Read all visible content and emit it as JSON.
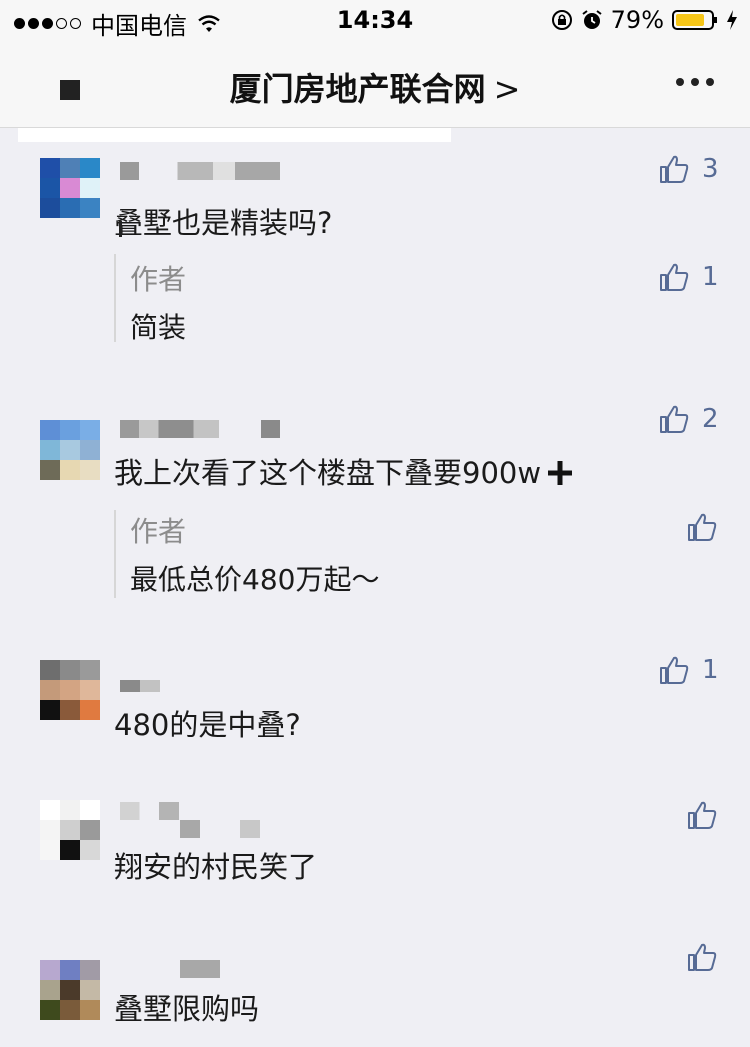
{
  "status_bar": {
    "carrier": "中国电信",
    "time": "14:34",
    "battery": "79%"
  },
  "nav": {
    "title": "厦门房地产联合网",
    "chevron": ">"
  },
  "comments": [
    {
      "text": "叠墅也是精装吗?",
      "likes": "3",
      "avatar_colors": [
        "#1f4fa8",
        "#4f80b6",
        "#2a88c8",
        "#1b55a6",
        "#d98ad4",
        "#dff2f8",
        "#1c4d9c",
        "#2a6db3",
        "#3b83c2"
      ],
      "reply": {
        "author": "作者",
        "text": "简装",
        "likes": "1"
      }
    },
    {
      "text": "我上次看了这个楼盘下叠要900w",
      "likes": "2",
      "avatar_colors": [
        "#5e8fd6",
        "#6aa0df",
        "#7aaee6",
        "#7fb7d8",
        "#a8c9e0",
        "#8fb1d4",
        "#6e6b58",
        "#e7d8b2",
        "#e8ddc2"
      ],
      "reply": {
        "author": "作者",
        "text": "最低总价480万起～",
        "likes": ""
      }
    },
    {
      "text": "480的是中叠?",
      "likes": "1",
      "avatar_colors": [
        "#6e6e6e",
        "#8a8a8a",
        "#9a9a9a",
        "#c49a7a",
        "#d3a483",
        "#dfb79a",
        "#111111",
        "#8a5a3a",
        "#e07a40"
      ],
      "avatar_row3b": "#221a16",
      "reply": null
    },
    {
      "text": "翔安的村民笑了",
      "likes": "",
      "avatar_colors": [
        "#ffffff",
        "#f2f2f2",
        "#ffffff",
        "#f4f4f4",
        "#cfcfcf",
        "#9a9a9a",
        "#f6f6f6",
        "#111111",
        "#d8d8d8"
      ],
      "reply": null
    },
    {
      "text": "叠墅限购吗",
      "likes": "",
      "avatar_colors": [
        "#b7a8cf",
        "#6f7fc2",
        "#a19ba6",
        "#a9a38d",
        "#4b3a2a",
        "#c4b9a6",
        "#3e4a1d",
        "#7a5b3a",
        "#b08a5a"
      ],
      "reply": null
    }
  ],
  "colors": {
    "background": "#efeff4",
    "link": "#576b95",
    "muted": "#8c8c8c"
  }
}
